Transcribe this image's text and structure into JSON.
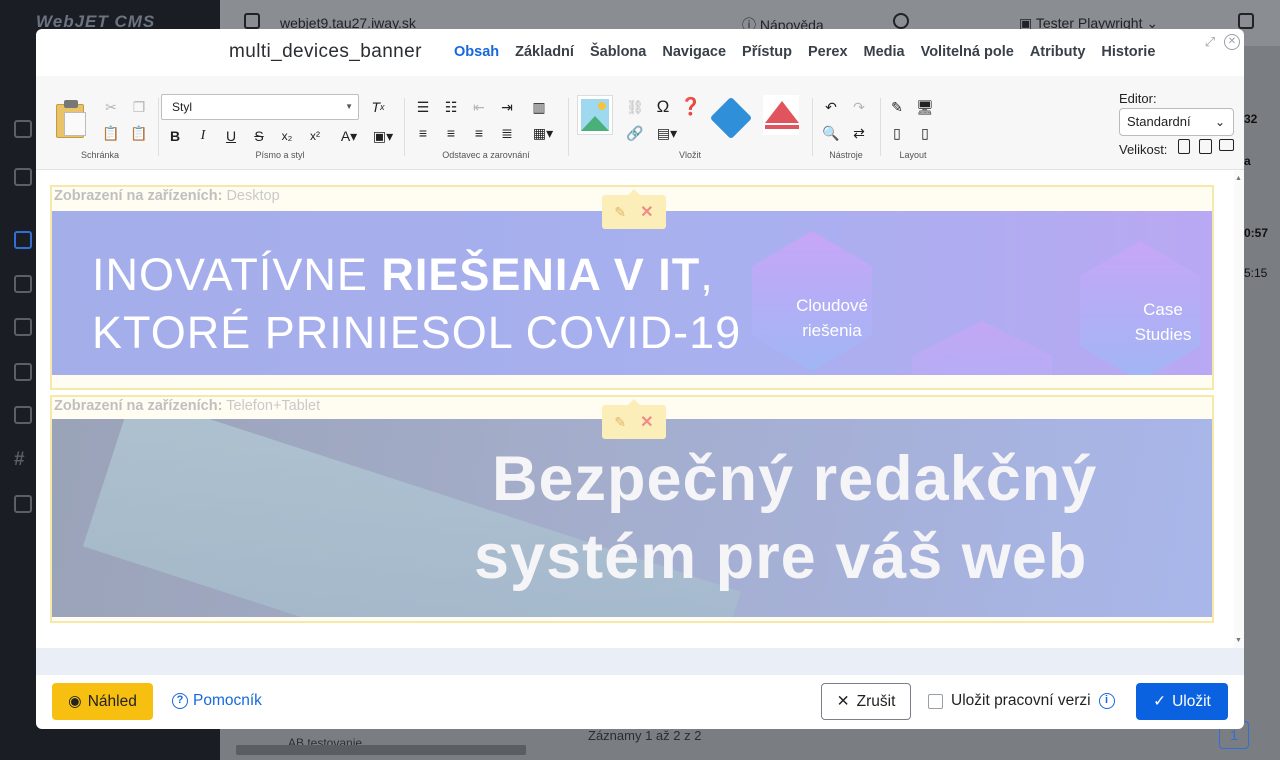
{
  "background": {
    "logo": "WebJET CMS",
    "url": "webjet9.tau27.iway.sk",
    "help": "Nápověda",
    "user": "Tester Playwright",
    "records": "Záznamy 1 až 2 z 2",
    "folder": "AB testovanie",
    "page_number": "1",
    "right_texts": [
      "32",
      "a",
      "0:57",
      "5:15"
    ]
  },
  "modal": {
    "title": "multi_devices_banner",
    "tabs": [
      {
        "label": "Obsah",
        "active": true
      },
      {
        "label": "Základní"
      },
      {
        "label": "Šablona"
      },
      {
        "label": "Navigace"
      },
      {
        "label": "Přístup"
      },
      {
        "label": "Perex"
      },
      {
        "label": "Media"
      },
      {
        "label": "Volitelná pole"
      },
      {
        "label": "Atributy"
      },
      {
        "label": "Historie"
      }
    ]
  },
  "toolbar": {
    "groups": [
      "Schránka",
      "Písmo a styl",
      "Odstavec a zarovnání",
      "Vložit",
      "Nástroje",
      "Layout"
    ],
    "style_select": "Styl",
    "editor_label": "Editor:",
    "editor_value": "Standardní",
    "size_label": "Velikost:"
  },
  "content": {
    "blocks": [
      {
        "label_key": "Zobrazení na zařízeních:",
        "label_value": "Desktop",
        "banner_line1_regular": "INOVATÍVNE ",
        "banner_line1_bold": "RIEŠENIA V IT",
        "banner_line1_tail": ",",
        "banner_line2": "KTORÉ PRINIESOL COVID-19",
        "tile1": "Cloudové riešenia",
        "tile2": "Case Studies"
      },
      {
        "label_key": "Zobrazení na zařízeních:",
        "label_value": "Telefon+Tablet",
        "banner_line1": "Bezpečný redakčný",
        "banner_line2": "systém pre váš web"
      }
    ]
  },
  "footer": {
    "preview": "Náhled",
    "helper": "Pomocník",
    "cancel": "Zrušit",
    "work_version": "Uložit pracovní verzi",
    "save": "Uložit"
  },
  "colors": {
    "accent": "#1668dc",
    "preview_button": "#f7bf0f",
    "save_button": "#0b62e0"
  }
}
